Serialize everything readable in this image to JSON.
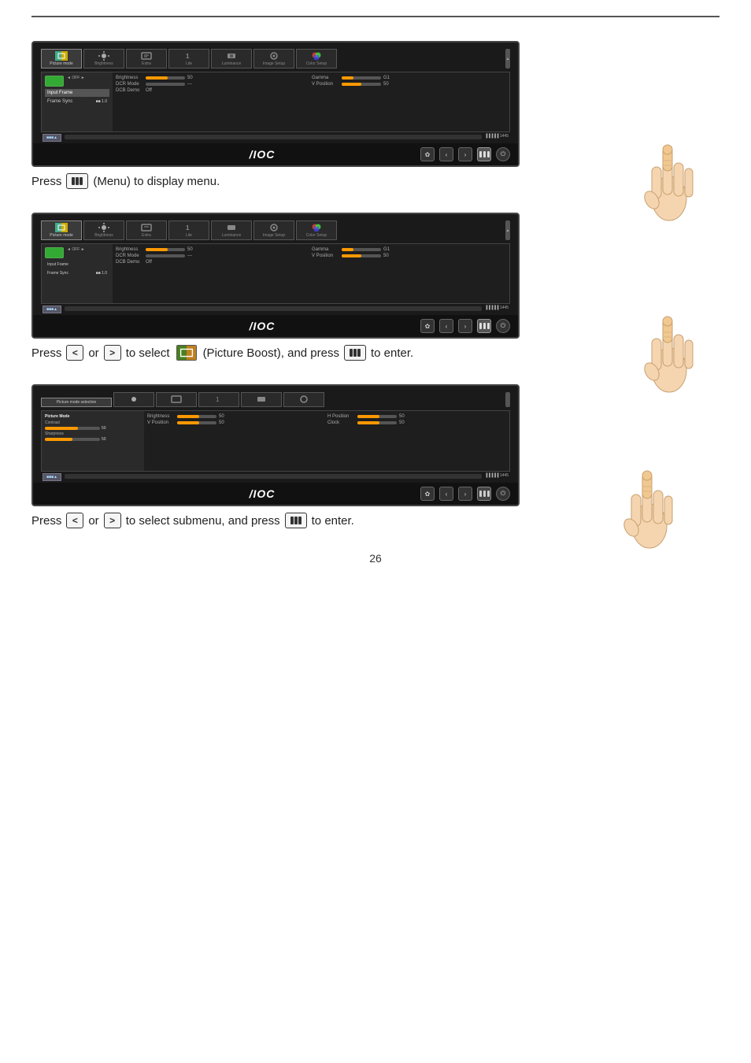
{
  "page": {
    "number": "26",
    "top_line": true
  },
  "sections": [
    {
      "id": "section1",
      "instruction_parts": [
        {
          "type": "text",
          "content": "Press"
        },
        {
          "type": "key",
          "content": "menu"
        },
        {
          "type": "text",
          "content": "(Menu) to display menu."
        }
      ]
    },
    {
      "id": "section2",
      "instruction_parts": [
        {
          "type": "text",
          "content": "Press"
        },
        {
          "type": "key",
          "content": "less"
        },
        {
          "type": "text",
          "content": "or"
        },
        {
          "type": "key",
          "content": "greater"
        },
        {
          "type": "text",
          "content": "to select"
        },
        {
          "type": "icon",
          "content": "picture-boost"
        },
        {
          "type": "text",
          "content": "(Picture Boost), and press"
        },
        {
          "type": "key",
          "content": "menu"
        },
        {
          "type": "text",
          "content": "to enter."
        }
      ]
    },
    {
      "id": "section3",
      "instruction_parts": [
        {
          "type": "text",
          "content": "Press"
        },
        {
          "type": "key",
          "content": "less"
        },
        {
          "type": "text",
          "content": "or"
        },
        {
          "type": "key",
          "content": "greater"
        },
        {
          "type": "text",
          "content": "to select submenu, and press"
        },
        {
          "type": "key",
          "content": "menu"
        },
        {
          "type": "text",
          "content": "to enter."
        }
      ]
    }
  ],
  "monitor": {
    "aoc_label": "/IOC",
    "tabs": [
      {
        "label": "Picture mode",
        "active": true
      },
      {
        "label": "Brightness",
        "active": false
      },
      {
        "label": "Extra",
        "active": false
      },
      {
        "label": "1\nLite",
        "active": false
      },
      {
        "label": "Luminance",
        "active": false
      },
      {
        "label": "Image Setup",
        "active": false
      },
      {
        "label": "Color Setup",
        "active": false
      }
    ],
    "left_menu": [
      {
        "label": "Input Frame",
        "active": true
      },
      {
        "label": "Frame Sync",
        "active": false
      }
    ],
    "right_items": [
      {
        "label": "Brightness",
        "value": "50"
      },
      {
        "label": "Contrast",
        "value": "50"
      },
      {
        "label": "DCB Mode",
        "value": "---"
      },
      {
        "label": "DCB Demo",
        "value": "Off"
      },
      {
        "label": "Gamma",
        "value": "Gamma1"
      },
      {
        "label": "V Position",
        "value": "50"
      }
    ]
  }
}
